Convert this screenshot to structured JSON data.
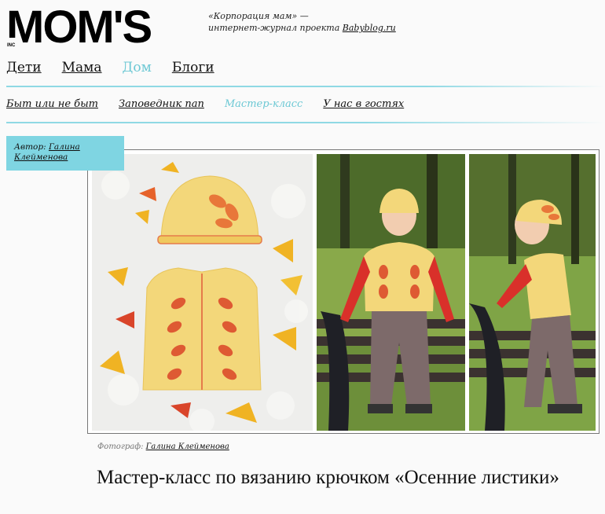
{
  "brand": {
    "logo_text": "MOM'S",
    "logo_small": "INC",
    "tagline_line1": "«Корпорация мам» —",
    "tagline_line2": "интернет-журнал проекта",
    "tagline_link": "Babyblog.ru"
  },
  "main_nav": [
    {
      "label": "Дети",
      "active": false
    },
    {
      "label": "Мама",
      "active": false
    },
    {
      "label": "Дом",
      "active": true
    },
    {
      "label": "Блоги",
      "active": false
    }
  ],
  "sub_nav": [
    {
      "label": "Быт или не быт",
      "active": false
    },
    {
      "label": "Заповедник пап",
      "active": false
    },
    {
      "label": "Мастер-класс",
      "active": true
    },
    {
      "label": "У нас в гостях",
      "active": false
    }
  ],
  "author": {
    "prefix": "Автор:",
    "name": "Галина Клейменова"
  },
  "photo_credit": {
    "prefix": "Фотограф:",
    "name": "Галина Клейменова"
  },
  "article": {
    "title": "Мастер-класс по вязанию крючком «Осенние листики»"
  },
  "colors": {
    "accent": "#6cc8d4",
    "author_box": "#7fd5e2"
  }
}
